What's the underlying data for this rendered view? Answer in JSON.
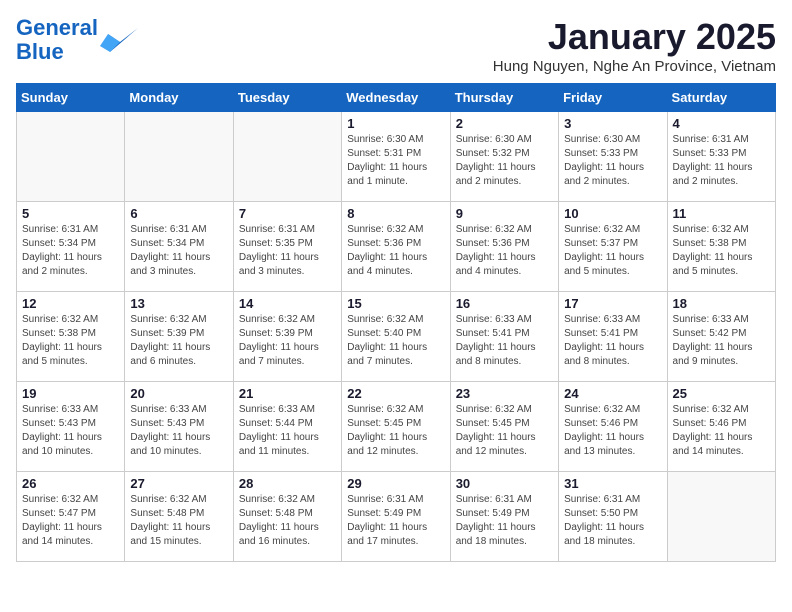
{
  "logo": {
    "line1": "General",
    "line2": "Blue"
  },
  "title": "January 2025",
  "location": "Hung Nguyen, Nghe An Province, Vietnam",
  "days_of_week": [
    "Sunday",
    "Monday",
    "Tuesday",
    "Wednesday",
    "Thursday",
    "Friday",
    "Saturday"
  ],
  "weeks": [
    [
      {
        "day": "",
        "info": ""
      },
      {
        "day": "",
        "info": ""
      },
      {
        "day": "",
        "info": ""
      },
      {
        "day": "1",
        "info": "Sunrise: 6:30 AM\nSunset: 5:31 PM\nDaylight: 11 hours\nand 1 minute."
      },
      {
        "day": "2",
        "info": "Sunrise: 6:30 AM\nSunset: 5:32 PM\nDaylight: 11 hours\nand 2 minutes."
      },
      {
        "day": "3",
        "info": "Sunrise: 6:30 AM\nSunset: 5:33 PM\nDaylight: 11 hours\nand 2 minutes."
      },
      {
        "day": "4",
        "info": "Sunrise: 6:31 AM\nSunset: 5:33 PM\nDaylight: 11 hours\nand 2 minutes."
      }
    ],
    [
      {
        "day": "5",
        "info": "Sunrise: 6:31 AM\nSunset: 5:34 PM\nDaylight: 11 hours\nand 2 minutes."
      },
      {
        "day": "6",
        "info": "Sunrise: 6:31 AM\nSunset: 5:34 PM\nDaylight: 11 hours\nand 3 minutes."
      },
      {
        "day": "7",
        "info": "Sunrise: 6:31 AM\nSunset: 5:35 PM\nDaylight: 11 hours\nand 3 minutes."
      },
      {
        "day": "8",
        "info": "Sunrise: 6:32 AM\nSunset: 5:36 PM\nDaylight: 11 hours\nand 4 minutes."
      },
      {
        "day": "9",
        "info": "Sunrise: 6:32 AM\nSunset: 5:36 PM\nDaylight: 11 hours\nand 4 minutes."
      },
      {
        "day": "10",
        "info": "Sunrise: 6:32 AM\nSunset: 5:37 PM\nDaylight: 11 hours\nand 5 minutes."
      },
      {
        "day": "11",
        "info": "Sunrise: 6:32 AM\nSunset: 5:38 PM\nDaylight: 11 hours\nand 5 minutes."
      }
    ],
    [
      {
        "day": "12",
        "info": "Sunrise: 6:32 AM\nSunset: 5:38 PM\nDaylight: 11 hours\nand 5 minutes."
      },
      {
        "day": "13",
        "info": "Sunrise: 6:32 AM\nSunset: 5:39 PM\nDaylight: 11 hours\nand 6 minutes."
      },
      {
        "day": "14",
        "info": "Sunrise: 6:32 AM\nSunset: 5:39 PM\nDaylight: 11 hours\nand 7 minutes."
      },
      {
        "day": "15",
        "info": "Sunrise: 6:32 AM\nSunset: 5:40 PM\nDaylight: 11 hours\nand 7 minutes."
      },
      {
        "day": "16",
        "info": "Sunrise: 6:33 AM\nSunset: 5:41 PM\nDaylight: 11 hours\nand 8 minutes."
      },
      {
        "day": "17",
        "info": "Sunrise: 6:33 AM\nSunset: 5:41 PM\nDaylight: 11 hours\nand 8 minutes."
      },
      {
        "day": "18",
        "info": "Sunrise: 6:33 AM\nSunset: 5:42 PM\nDaylight: 11 hours\nand 9 minutes."
      }
    ],
    [
      {
        "day": "19",
        "info": "Sunrise: 6:33 AM\nSunset: 5:43 PM\nDaylight: 11 hours\nand 10 minutes."
      },
      {
        "day": "20",
        "info": "Sunrise: 6:33 AM\nSunset: 5:43 PM\nDaylight: 11 hours\nand 10 minutes."
      },
      {
        "day": "21",
        "info": "Sunrise: 6:33 AM\nSunset: 5:44 PM\nDaylight: 11 hours\nand 11 minutes."
      },
      {
        "day": "22",
        "info": "Sunrise: 6:32 AM\nSunset: 5:45 PM\nDaylight: 11 hours\nand 12 minutes."
      },
      {
        "day": "23",
        "info": "Sunrise: 6:32 AM\nSunset: 5:45 PM\nDaylight: 11 hours\nand 12 minutes."
      },
      {
        "day": "24",
        "info": "Sunrise: 6:32 AM\nSunset: 5:46 PM\nDaylight: 11 hours\nand 13 minutes."
      },
      {
        "day": "25",
        "info": "Sunrise: 6:32 AM\nSunset: 5:46 PM\nDaylight: 11 hours\nand 14 minutes."
      }
    ],
    [
      {
        "day": "26",
        "info": "Sunrise: 6:32 AM\nSunset: 5:47 PM\nDaylight: 11 hours\nand 14 minutes."
      },
      {
        "day": "27",
        "info": "Sunrise: 6:32 AM\nSunset: 5:48 PM\nDaylight: 11 hours\nand 15 minutes."
      },
      {
        "day": "28",
        "info": "Sunrise: 6:32 AM\nSunset: 5:48 PM\nDaylight: 11 hours\nand 16 minutes."
      },
      {
        "day": "29",
        "info": "Sunrise: 6:31 AM\nSunset: 5:49 PM\nDaylight: 11 hours\nand 17 minutes."
      },
      {
        "day": "30",
        "info": "Sunrise: 6:31 AM\nSunset: 5:49 PM\nDaylight: 11 hours\nand 18 minutes."
      },
      {
        "day": "31",
        "info": "Sunrise: 6:31 AM\nSunset: 5:50 PM\nDaylight: 11 hours\nand 18 minutes."
      },
      {
        "day": "",
        "info": ""
      }
    ]
  ]
}
